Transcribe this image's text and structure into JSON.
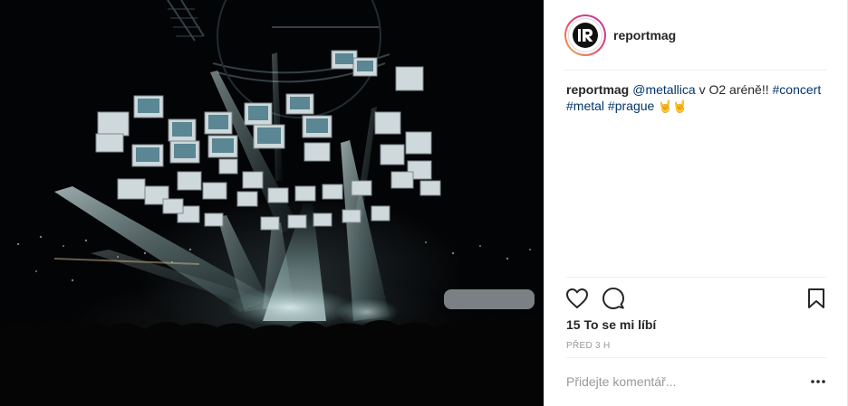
{
  "post": {
    "photo": {
      "description_icon": "concert-stage-photo"
    },
    "header": {
      "username": "reportmag",
      "avatar_letter": "R",
      "avatar_icon": "reportmag-logo-icon"
    },
    "caption": {
      "username": "reportmag",
      "mention": "@metallica",
      "text": "v O2 aréně!!",
      "tags": [
        "#concert",
        "#metal",
        "#prague"
      ],
      "emoji": "🤘🤘"
    },
    "actions": {
      "like_icon": "heart-icon",
      "comment_icon": "comment-icon",
      "save_icon": "bookmark-icon"
    },
    "likes_text": "15 To se mi líbí",
    "time_text": "PŘED 3 H",
    "comment": {
      "placeholder": "Přidejte komentář...",
      "more_icon": "more-options-icon"
    },
    "colors": {
      "tag_link": "#003569",
      "text": "#262626",
      "muted": "#999999",
      "divider": "#efefef"
    }
  }
}
